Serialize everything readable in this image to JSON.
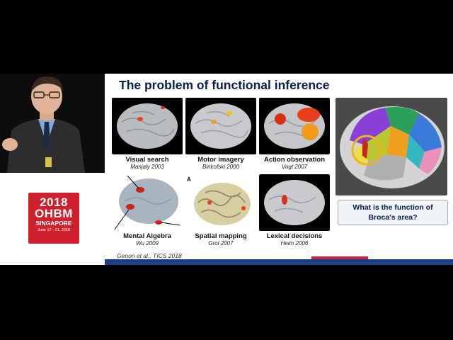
{
  "slide": {
    "title": "The problem of functional inference",
    "citation": "Genon et al., TICS 2018",
    "question": "What is the function of Broca's area?",
    "panel_letter": "A",
    "panels": [
      {
        "label": "Visual search",
        "ref": "Manjaly 2003"
      },
      {
        "label": "Motor imagery",
        "ref": "Binkofski 2000"
      },
      {
        "label": "Action observation",
        "ref": "Vogt 2007"
      },
      {
        "label": "Mental Algebra",
        "ref": "Wu 2009"
      },
      {
        "label": "Spatial mapping",
        "ref": "Grol 2007"
      },
      {
        "label": "Lexical decisions",
        "ref": "Heim 2006"
      }
    ]
  },
  "logo": {
    "year": "2018",
    "name": "OHBM",
    "city": "SINGAPORE",
    "dates": "June 17 - 21, 2018"
  },
  "colors": {
    "title": "#0b1f4d",
    "logo_red": "#d0202e",
    "activation": "#e8401c",
    "bar_blue": "#1f3f85"
  }
}
